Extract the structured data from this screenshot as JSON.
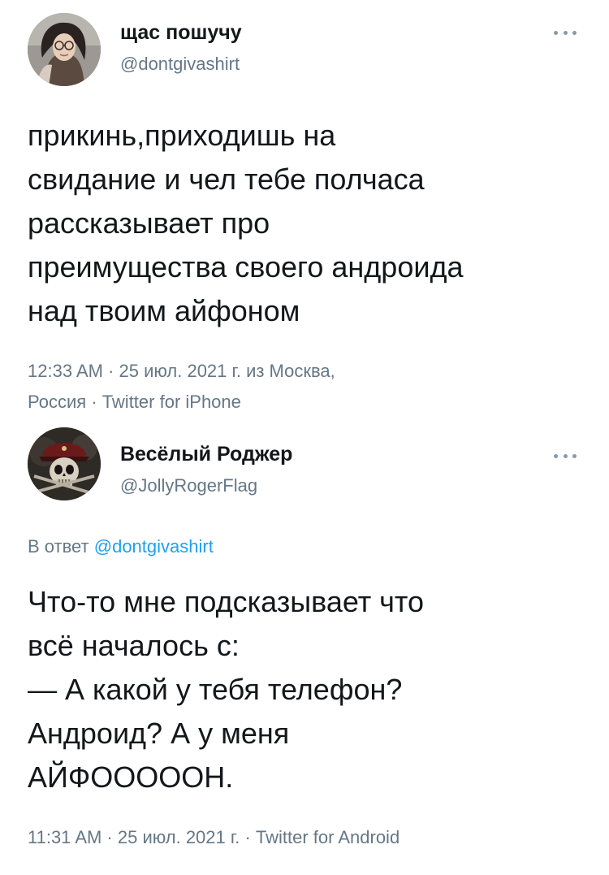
{
  "tweets": [
    {
      "display_name": "щас пошучу",
      "handle": "@dontgivashirt",
      "text": "прикинь,приходишь на\nсвидание и чел тебе полчаса\nрассказывает про\nпреимущества своего андроида\nнад твоим айфоном",
      "meta_line1": "12:33 AM · 25 июл. 2021 г. из Москва,",
      "meta_line2": "Россия · Twitter for iPhone",
      "avatar_icon": "user-photo-avatar",
      "more_icon": "more-dots-icon"
    },
    {
      "display_name": "Весёлый Роджер",
      "handle": "@JollyRogerFlag",
      "reply_prefix": "В ответ ",
      "reply_handle": "@dontgivashirt",
      "text": "Что-то мне подсказывает что\nвсё началось с:\n— А какой у тебя телефон?\nАндроид? А у меня\nАЙФООООOН.",
      "meta_line1": "11:31 AM · 25 июл. 2021 г. · Twitter for Android",
      "avatar_icon": "skull-avatar",
      "more_icon": "more-dots-icon"
    }
  ],
  "colors": {
    "text": "#14171a",
    "secondary": "#657786",
    "link": "#1da1f2",
    "dots": "#8899a6"
  }
}
